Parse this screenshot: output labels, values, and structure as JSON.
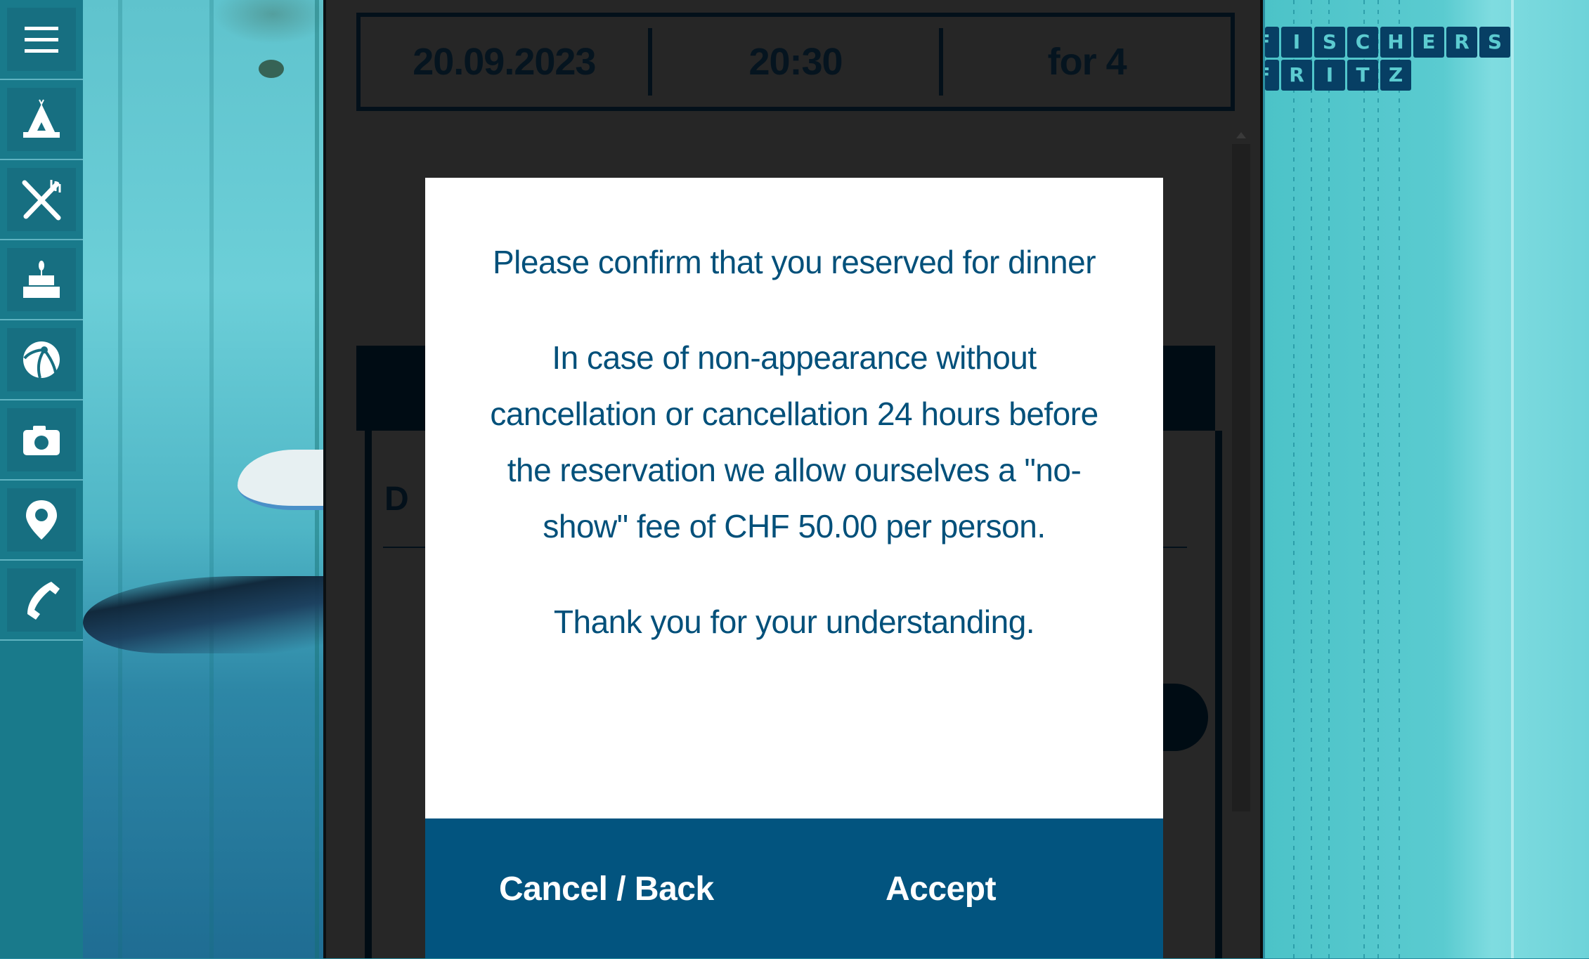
{
  "sidebar": {
    "items": [
      {
        "name": "menu",
        "icon": "hamburger-menu-icon"
      },
      {
        "name": "camping",
        "icon": "tent-icon"
      },
      {
        "name": "restaurant",
        "icon": "fork-knife-icon"
      },
      {
        "name": "events",
        "icon": "cake-icon"
      },
      {
        "name": "beach",
        "icon": "beach-ball-icon"
      },
      {
        "name": "gallery",
        "icon": "camera-icon"
      },
      {
        "name": "location",
        "icon": "map-pin-icon"
      },
      {
        "name": "contact",
        "icon": "phone-icon"
      }
    ]
  },
  "logo": {
    "line1": [
      "I",
      "S",
      "C",
      "H",
      "E",
      "R",
      "S"
    ],
    "line2": [
      "R",
      "I",
      "T",
      "Z"
    ],
    "partial_first_line1": "F",
    "partial_first_line2": "F"
  },
  "reservation_summary": {
    "date": "20.09.2023",
    "time": "20:30",
    "guests": "for 4"
  },
  "background_form": {
    "partial_label": "D"
  },
  "dialog": {
    "title": "Please confirm that you reserved for dinner",
    "message": "In case of non-appearance without cancellation or cancellation 24 hours before the reservation we allow ourselves a \"no-show\" fee of CHF 50.00 per person.",
    "closing": "Thank you for your understanding.",
    "cancel_label": "Cancel / Back",
    "accept_label": "Accept"
  },
  "colors": {
    "sidebar": "#197a8b",
    "dialog_text": "#02507a",
    "dialog_actions_bg": "#02547f",
    "overlay_panel": "#262626",
    "logo_tile": "#073f64"
  }
}
